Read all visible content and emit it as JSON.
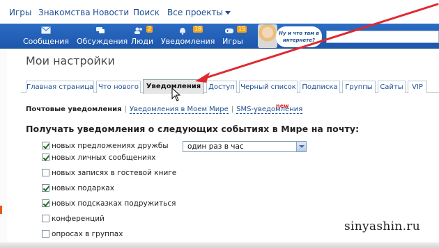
{
  "top_links": {
    "games": "Игры",
    "dating": "Знакомства",
    "news": "Новости",
    "search": "Поиск",
    "all_projects": "Все проекты"
  },
  "nav": {
    "messages": "Сообщения",
    "discussions": "Обсуждения",
    "people": "Люди",
    "people_badge": "2",
    "notifications": "Уведомления",
    "notifications_badge": "18",
    "games": "Игры",
    "games_badge": "15",
    "promo_text": "Ну и что там в интернете?"
  },
  "page_title": "Мои настройки",
  "tabs": [
    {
      "label": "Главная страница",
      "active": false
    },
    {
      "label": "Что нового",
      "active": false
    },
    {
      "label": "Уведомления",
      "active": true
    },
    {
      "label": "Доступ",
      "active": false
    },
    {
      "label": "Черный список",
      "active": false
    },
    {
      "label": "Подписка",
      "active": false
    },
    {
      "label": "Группы",
      "active": false
    },
    {
      "label": "Сайты",
      "active": false
    },
    {
      "label": "VIP",
      "active": false
    }
  ],
  "subnav": {
    "current": "Почтовые уведомления",
    "in_my_world": "Уведомления в Моем Мире",
    "sms": "SMS-уведомления",
    "new_tag": "new"
  },
  "section_title": "Получать уведомления о следующих событиях в Мире на почту:",
  "options": [
    {
      "label": "новых предложениях дружбы",
      "checked": true
    },
    {
      "label": "новых личных сообщениях",
      "checked": true
    },
    {
      "label": "новых записях в гостевой книге",
      "checked": false
    },
    {
      "label": "новых подарках",
      "checked": true
    },
    {
      "label": "новых подсказках подружиться",
      "checked": true
    },
    {
      "label": "конференций",
      "checked": false
    },
    {
      "label": "опросах в группах",
      "checked": false
    }
  ],
  "frequency_select": {
    "value": "один раз в час"
  },
  "watermark": "sinyashin.ru",
  "colors": {
    "nav_blue": "#2b6cc4",
    "link": "#1a4e94",
    "annotation_arrow": "#e0282e",
    "badge": "#f2a31b"
  }
}
